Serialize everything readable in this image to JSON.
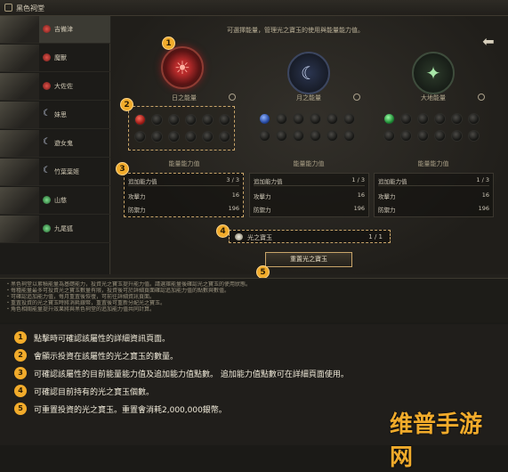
{
  "window": {
    "title": "黑色祠堂"
  },
  "sidebar": {
    "items": [
      {
        "label": "吉備津",
        "type": "red"
      },
      {
        "label": "魔獸",
        "type": "red"
      },
      {
        "label": "大佐佐",
        "type": "red"
      },
      {
        "label": "妹思",
        "type": "moon"
      },
      {
        "label": "遊女鬼",
        "type": "moon"
      },
      {
        "label": "竹葉葉姬",
        "type": "moon"
      },
      {
        "label": "山慈",
        "type": "green"
      },
      {
        "label": "九尾狐",
        "type": "green"
      }
    ]
  },
  "main": {
    "hint": "可選擇能量，管理光之寶玉的使用與能量能力值。",
    "columns": [
      {
        "title": "日之能量",
        "emblem": "sun",
        "slots": [
          "red",
          "empty",
          "empty",
          "empty",
          "empty",
          "empty",
          "empty",
          "empty",
          "empty",
          "empty",
          "empty",
          "empty"
        ],
        "section_title": "能量能力值",
        "stats": {
          "head_label": "追加能力值",
          "head_value": "3 / 3",
          "rows": [
            {
              "label": "攻擊力",
              "value": "16"
            },
            {
              "label": "防禦力",
              "value": "196"
            }
          ]
        }
      },
      {
        "title": "月之能量",
        "emblem": "moon",
        "slots": [
          "blue",
          "empty",
          "empty",
          "empty",
          "empty",
          "empty",
          "empty",
          "empty",
          "empty",
          "empty",
          "empty",
          "empty"
        ],
        "section_title": "能量能力值",
        "stats": {
          "head_label": "追加能力值",
          "head_value": "1 / 3",
          "rows": [
            {
              "label": "攻擊力",
              "value": "16"
            },
            {
              "label": "防禦力",
              "value": "196"
            }
          ]
        }
      },
      {
        "title": "大地能量",
        "emblem": "star",
        "slots": [
          "green",
          "empty",
          "empty",
          "empty",
          "empty",
          "empty",
          "empty",
          "empty",
          "empty",
          "empty",
          "empty",
          "empty"
        ],
        "section_title": "能量能力值",
        "stats": {
          "head_label": "追加能力值",
          "head_value": "1 / 3",
          "rows": [
            {
              "label": "攻擊力",
              "value": "16"
            },
            {
              "label": "防禦力",
              "value": "196"
            }
          ]
        }
      }
    ],
    "gem_bar": {
      "label": "光之寶玉",
      "count": "1 / 1"
    },
    "reset_button": "重置光之寶玉"
  },
  "notes": [
    "・黑色祠堂以累積能量為基礎能力，投資光之寶玉提升能力值。請選擇能量後確認光之寶玉的使用狀態。",
    "・每種能量最多可投資光之寶玉數量有限，投資後可於詳細頁面確認追加能力值的點數與數值。",
    "・可確認追加能力值，每月重置後恢復，可前往詳細資訊頁面。",
    "・重置投資的光之寶玉時將消耗銀幣，重置後可重新分配光之寶玉。",
    "・角色相關能量提升效果將與黑色祠堂的追加能力值共同計算。"
  ],
  "legend": [
    {
      "num": "1",
      "text": "點擊時可確認該屬性的詳細資訊頁面。"
    },
    {
      "num": "2",
      "text": "會顯示投資在該屬性的光之寶玉的數量。"
    },
    {
      "num": "3",
      "text": "可確認該屬性的目前能量能力值及追加能力值點數。  追加能力值點數可在詳細頁面使用。"
    },
    {
      "num": "4",
      "text": "可確認目前持有的光之寶玉個數。"
    },
    {
      "num": "5",
      "text": "可重置投資的光之寶玉。重置會消耗2,000,000銀幣。"
    }
  ],
  "watermark": "维普手游网",
  "colors": {
    "accent": "#f1ab2b",
    "dashed_border": "#c9a56a"
  }
}
